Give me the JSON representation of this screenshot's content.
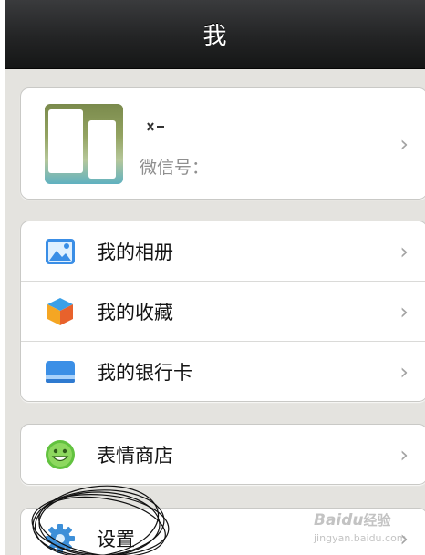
{
  "header": {
    "title": "我"
  },
  "profile": {
    "wechat_id_label": "微信号：",
    "chevron": "›"
  },
  "groups": [
    {
      "items": [
        {
          "label": "我的相册",
          "icon": "album-icon",
          "chevron": "›"
        },
        {
          "label": "我的收藏",
          "icon": "favorites-icon",
          "chevron": "›"
        },
        {
          "label": "我的银行卡",
          "icon": "bank-card-icon",
          "chevron": "›"
        }
      ]
    },
    {
      "items": [
        {
          "label": "表情商店",
          "icon": "sticker-store-icon",
          "chevron": "›"
        }
      ]
    },
    {
      "items": [
        {
          "label": "设置",
          "icon": "settings-gear-icon",
          "chevron": "›"
        }
      ]
    }
  ],
  "watermark": {
    "text_en": "Baidu",
    "text_cn": "经验",
    "sub": "jingyan.baidu.com"
  },
  "colors": {
    "titlebar": "#232425",
    "background": "#e4e3df",
    "card": "#ffffff",
    "secondary_text": "#8f8f8f",
    "chevron": "#a3a3a3"
  }
}
